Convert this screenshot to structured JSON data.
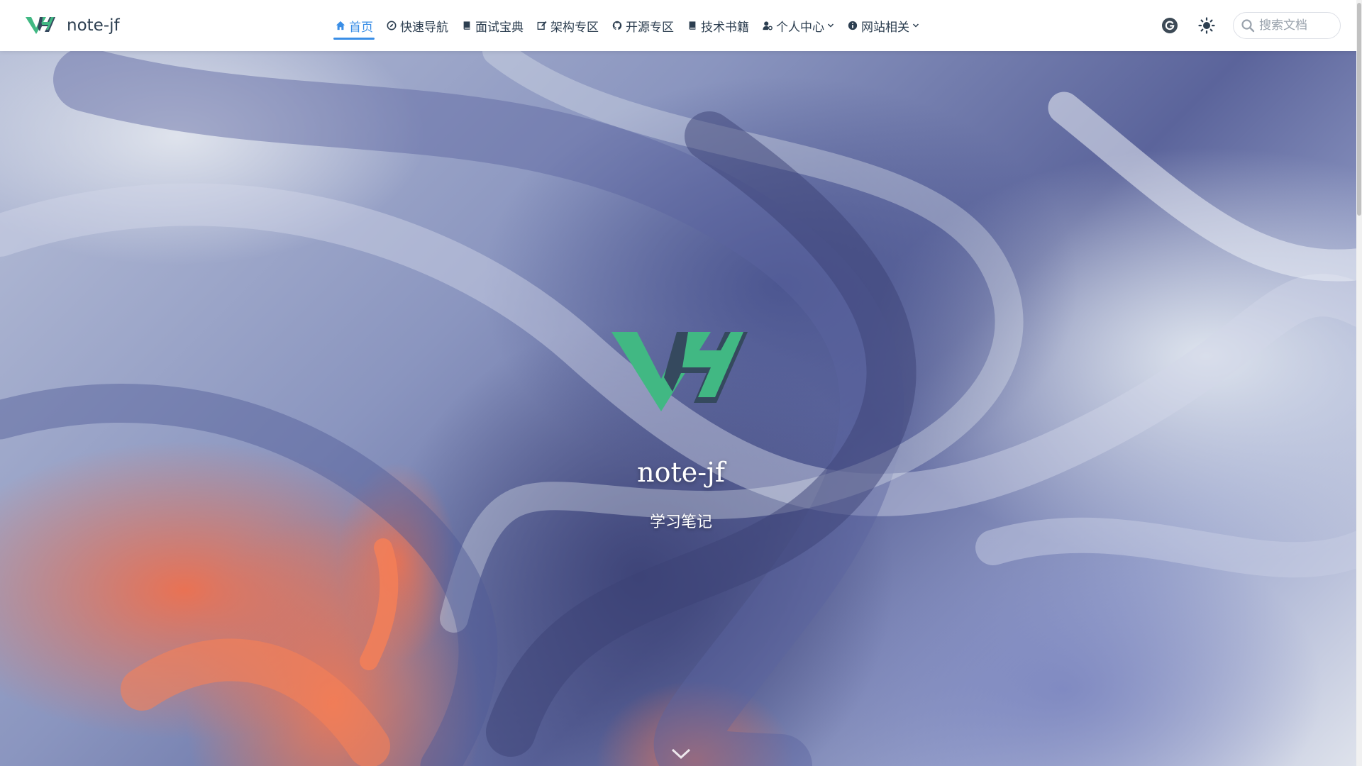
{
  "navbar": {
    "brand": {
      "title": "note-jf",
      "logo": "vh-logo"
    },
    "items": [
      {
        "label": "首页",
        "icon": "home-icon",
        "active": true,
        "dropdown": false
      },
      {
        "label": "快速导航",
        "icon": "compass-icon",
        "active": false,
        "dropdown": false
      },
      {
        "label": "面试宝典",
        "icon": "book-icon",
        "active": false,
        "dropdown": false
      },
      {
        "label": "架构专区",
        "icon": "edit-icon",
        "active": false,
        "dropdown": false
      },
      {
        "label": "开源专区",
        "icon": "github-icon",
        "active": false,
        "dropdown": false
      },
      {
        "label": "技术书籍",
        "icon": "book-icon",
        "active": false,
        "dropdown": false
      },
      {
        "label": "个人中心",
        "icon": "user-gear-icon",
        "active": false,
        "dropdown": true
      },
      {
        "label": "网站相关",
        "icon": "info-icon",
        "active": false,
        "dropdown": true
      }
    ],
    "right": {
      "translate_icon": "g-translate-icon",
      "theme_icon": "sun-icon",
      "search": {
        "placeholder": "搜索文档",
        "value": ""
      }
    }
  },
  "hero": {
    "logo": "vh-logo",
    "title": "note-jf",
    "subtitle": "学习笔记",
    "scroll_icon": "chevron-down-icon"
  },
  "colors": {
    "accent": "#3a8ee6",
    "logo_green": "#41b883",
    "logo_dark": "#35495e",
    "text": "#2c3e50"
  }
}
